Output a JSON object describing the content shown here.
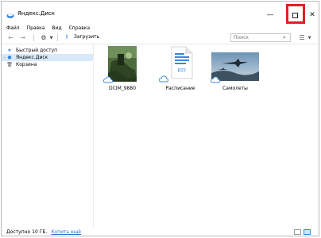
{
  "window": {
    "title": "Яндекс.Диск"
  },
  "menu": [
    "Файл",
    "Правка",
    "Вид",
    "Справка"
  ],
  "toolbar": {
    "upload_label": "Загрузить"
  },
  "search": {
    "placeholder": "Поиск"
  },
  "sidebar": {
    "items": [
      {
        "label": "Быстрый доступ",
        "icon": "star-icon"
      },
      {
        "label": "Яндекс.Диск",
        "icon": "yandex-disk-icon",
        "selected": true
      },
      {
        "label": "Корзина",
        "icon": "trash-icon"
      }
    ]
  },
  "files": [
    {
      "name": "DCIM_9880",
      "type": "photo"
    },
    {
      "name": "Расписание",
      "type": "rtf",
      "badge": "RTF"
    },
    {
      "name": "Самолеты",
      "type": "photo"
    }
  ],
  "status": {
    "text": "Доступно 10 ГБ.",
    "link": "Купить ещё"
  },
  "colors": {
    "accent": "#3b86d9",
    "highlight": "#e02020",
    "selection": "#d9e9f9"
  }
}
